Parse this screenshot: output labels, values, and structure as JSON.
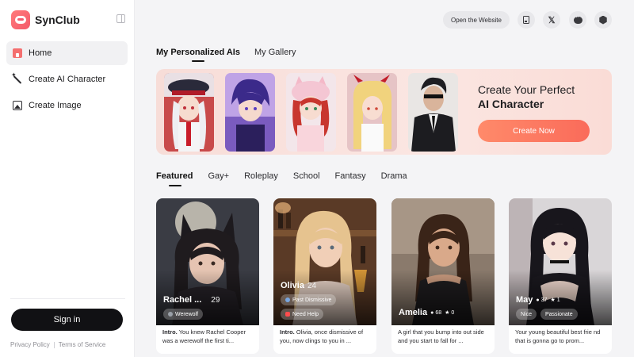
{
  "brand": {
    "name": "SynClub"
  },
  "sidebar": {
    "items": [
      {
        "label": "Home",
        "icon": "home-icon",
        "active": true
      },
      {
        "label": "Create AI Character",
        "icon": "magic-wand-icon"
      },
      {
        "label": "Create Image",
        "icon": "image-icon"
      }
    ],
    "signin_label": "Sign in",
    "footer": {
      "privacy": "Privacy Policy",
      "terms": "Terms of Service"
    }
  },
  "topbar": {
    "open_website": "Open the Website",
    "icons": [
      "bookmark-icon",
      "x-icon",
      "discord-icon",
      "settings-icon"
    ]
  },
  "main": {
    "tabs": [
      {
        "label": "My Personalized AIs",
        "active": true
      },
      {
        "label": "My Gallery"
      }
    ],
    "banner": {
      "title_line1": "Create Your Perfect",
      "title_line2": "AI Character",
      "button": "Create Now"
    },
    "categories": [
      {
        "label": "Featured",
        "active": true
      },
      {
        "label": "Gay+"
      },
      {
        "label": "Roleplay"
      },
      {
        "label": "School"
      },
      {
        "label": "Fantasy"
      },
      {
        "label": "Drama"
      }
    ],
    "cards": [
      {
        "name": "Rachel ...",
        "age": "29",
        "tags": [
          "Werewolf"
        ],
        "intro_label": "Intro.",
        "desc": "You knew Rachel Cooper was a werewolf the first ti..."
      },
      {
        "name": "Olivia",
        "age": "24",
        "tags": [
          "Past Dismissive",
          "Need Help"
        ],
        "intro_label": "Intro.",
        "desc": "Olivia, once dismissive of you, now clings to you in ..."
      },
      {
        "name": "Amelia",
        "likes": "68",
        "stars": "0",
        "desc": "A girl that you bump into out side and you start to fall for ..."
      },
      {
        "name": "May",
        "likes": "37",
        "stars": "1",
        "tags": [
          "Nice",
          "Passionate"
        ],
        "desc": "Your young beautiful best frie nd that is gonna go to prom..."
      }
    ]
  },
  "colors": {
    "accent": "#fa6b5a",
    "dark": "#111114"
  }
}
